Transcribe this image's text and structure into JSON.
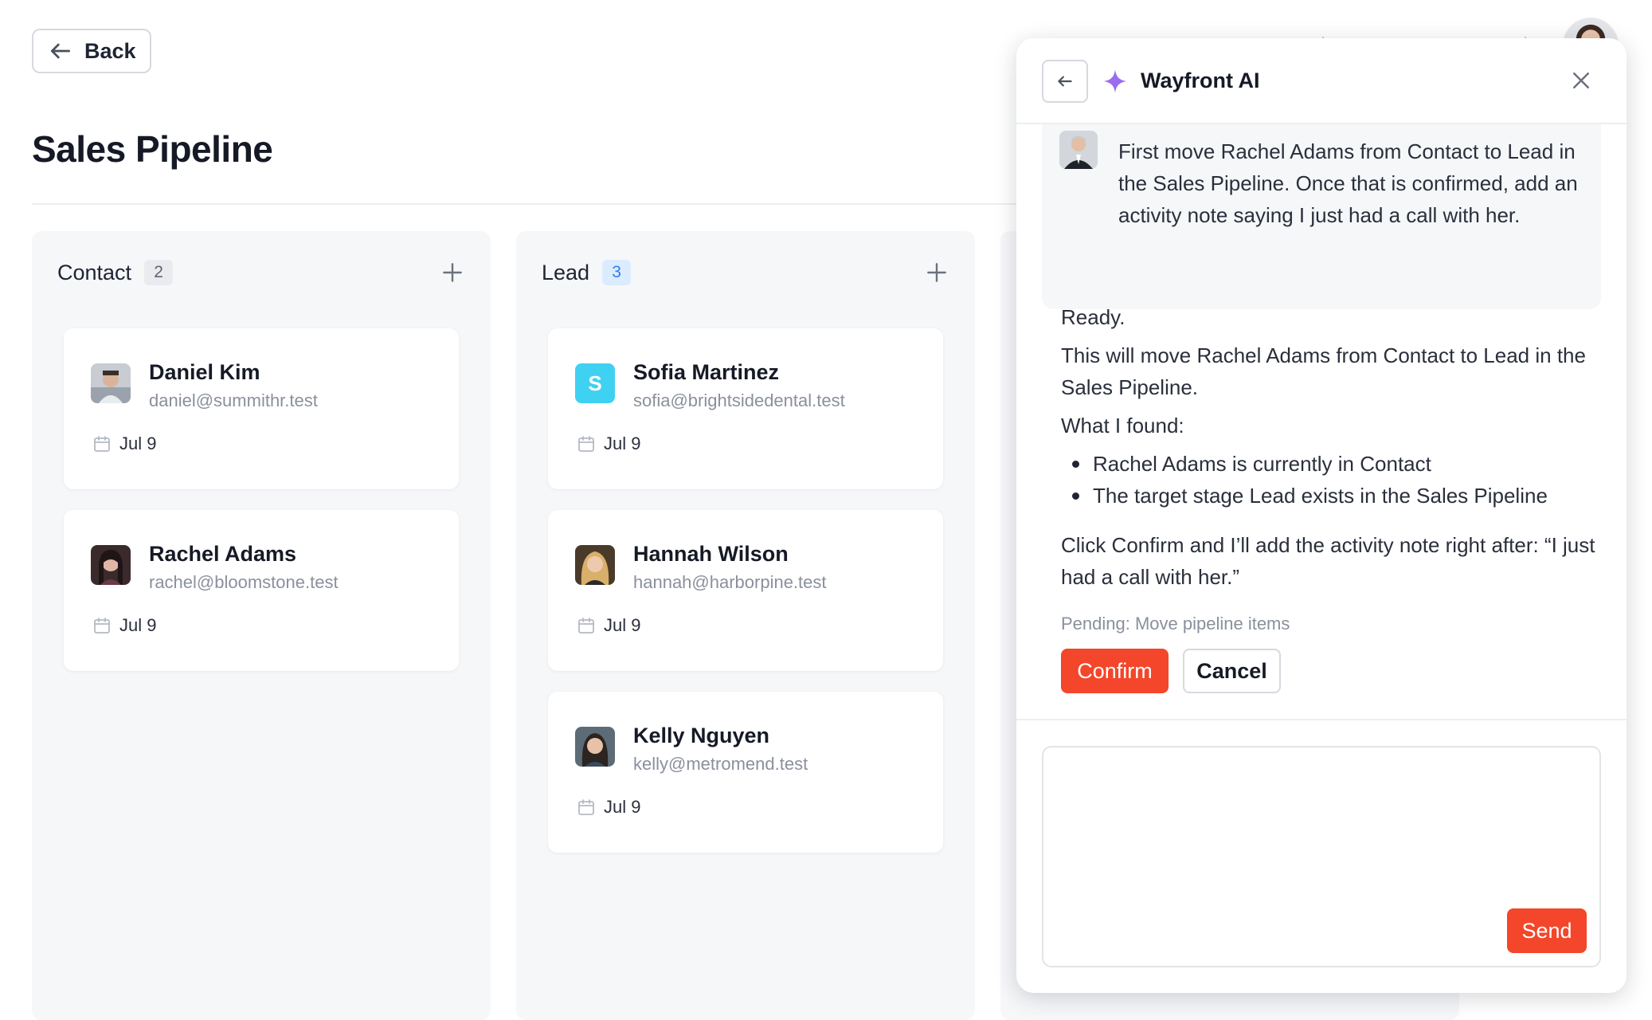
{
  "toolbar": {
    "back_label": "Back"
  },
  "page": {
    "title": "Sales Pipeline"
  },
  "columns": [
    {
      "title": "Contact",
      "count": "2",
      "cards": [
        {
          "name": "Daniel Kim",
          "email": "daniel@summithr.test",
          "date": "Jul 9"
        },
        {
          "name": "Rachel Adams",
          "email": "rachel@bloomstone.test",
          "date": "Jul 9"
        }
      ]
    },
    {
      "title": "Lead",
      "count": "3",
      "cards": [
        {
          "name": "Sofia Martinez",
          "email": "sofia@brightsidedental.test",
          "date": "Jul 9",
          "avatar_letter": "S"
        },
        {
          "name": "Hannah Wilson",
          "email": "hannah@harborpine.test",
          "date": "Jul 9"
        },
        {
          "name": "Kelly Nguyen",
          "email": "kelly@metromend.test",
          "date": "Jul 9"
        }
      ]
    }
  ],
  "assistant_panel": {
    "title": "Wayfront AI",
    "user_message": "First move Rachel Adams from Contact to Lead in the Sales Pipeline. Once that is confirmed, add an activity note saying I just had a call with her.",
    "reply": {
      "status": "Ready.",
      "summary": "This will move Rachel Adams from Contact to Lead in the Sales Pipeline.",
      "found_heading": "What I found:",
      "findings": [
        "Rachel Adams is currently in Contact",
        "The target stage Lead exists in the Sales Pipeline"
      ],
      "followup": "Click Confirm and I’ll add the activity note right after: “I just had a call with her.”"
    },
    "pending": "Pending: Move pipeline items",
    "confirm_label": "Confirm",
    "cancel_label": "Cancel",
    "composer_value": "",
    "send_label": "Send"
  },
  "colors": {
    "accent": "#f4462a",
    "count_blue_text": "#2d7ff0",
    "count_blue_bg": "#dcecff",
    "sparkle": "#9a6cf0",
    "column_bg": "#f6f7f9"
  },
  "icons": [
    "arrow-left-icon",
    "plus-icon",
    "calendar-icon",
    "sparkle-icon",
    "close-icon"
  ]
}
